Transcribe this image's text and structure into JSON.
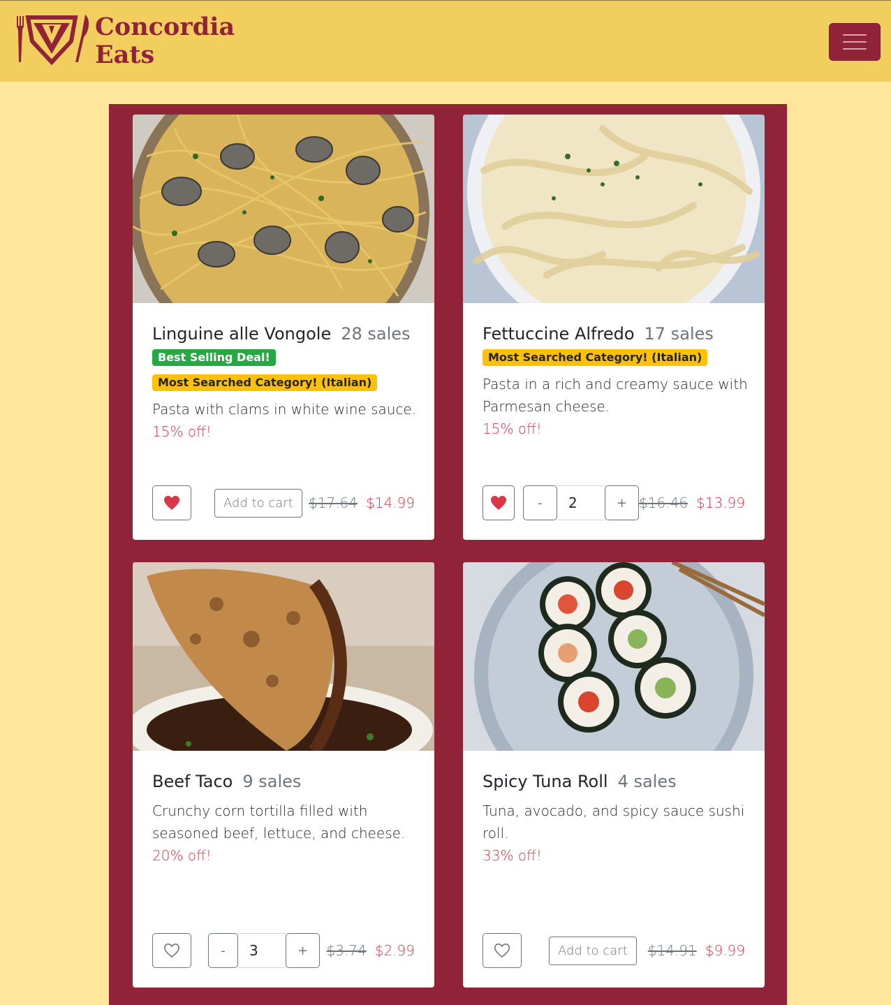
{
  "brand": {
    "line1": "Concordia",
    "line2": "Eats",
    "color": "#912338"
  },
  "navbar": {
    "toggle_icon": "hamburger-icon"
  },
  "products": [
    {
      "title": "Linguine alle Vongole",
      "sales": "28 sales",
      "badges": [
        "Best Selling Deal!",
        "Most Searched Category! (Italian)"
      ],
      "description": "Pasta with clams in white wine sauce.",
      "discount": "15% off!",
      "favorited": true,
      "cart_label": "Add to cart",
      "old_price": "$17.64",
      "new_price": "$14.99",
      "image": "pasta with clams photo"
    },
    {
      "title": "Fettuccine Alfredo",
      "sales": "17 sales",
      "badges": [
        "Most Searched Category! (Italian)"
      ],
      "description": "Pasta in a rich and creamy sauce with Parmesan cheese.",
      "discount": "15% off!",
      "favorited": true,
      "quantity": "2",
      "minus": "-",
      "plus": "+",
      "old_price": "$16.46",
      "new_price": "$13.99",
      "image": "fettuccine alfredo photo"
    },
    {
      "title": "Beef Taco",
      "sales": "9 sales",
      "badges": [],
      "description": "Crunchy corn tortilla filled with seasoned beef, lettuce, and cheese.",
      "discount": "20% off!",
      "favorited": false,
      "quantity": "3",
      "minus": "-",
      "plus": "+",
      "old_price": "$3.74",
      "new_price": "$2.99",
      "image": "birria taco photo"
    },
    {
      "title": "Spicy Tuna Roll",
      "sales": "4 sales",
      "badges": [],
      "description": "Tuna, avocado, and spicy sauce sushi roll.",
      "discount": "33% off!",
      "favorited": false,
      "cart_label": "Add to cart",
      "old_price": "$14.91",
      "new_price": "$9.99",
      "image": "sushi roll photo"
    }
  ]
}
